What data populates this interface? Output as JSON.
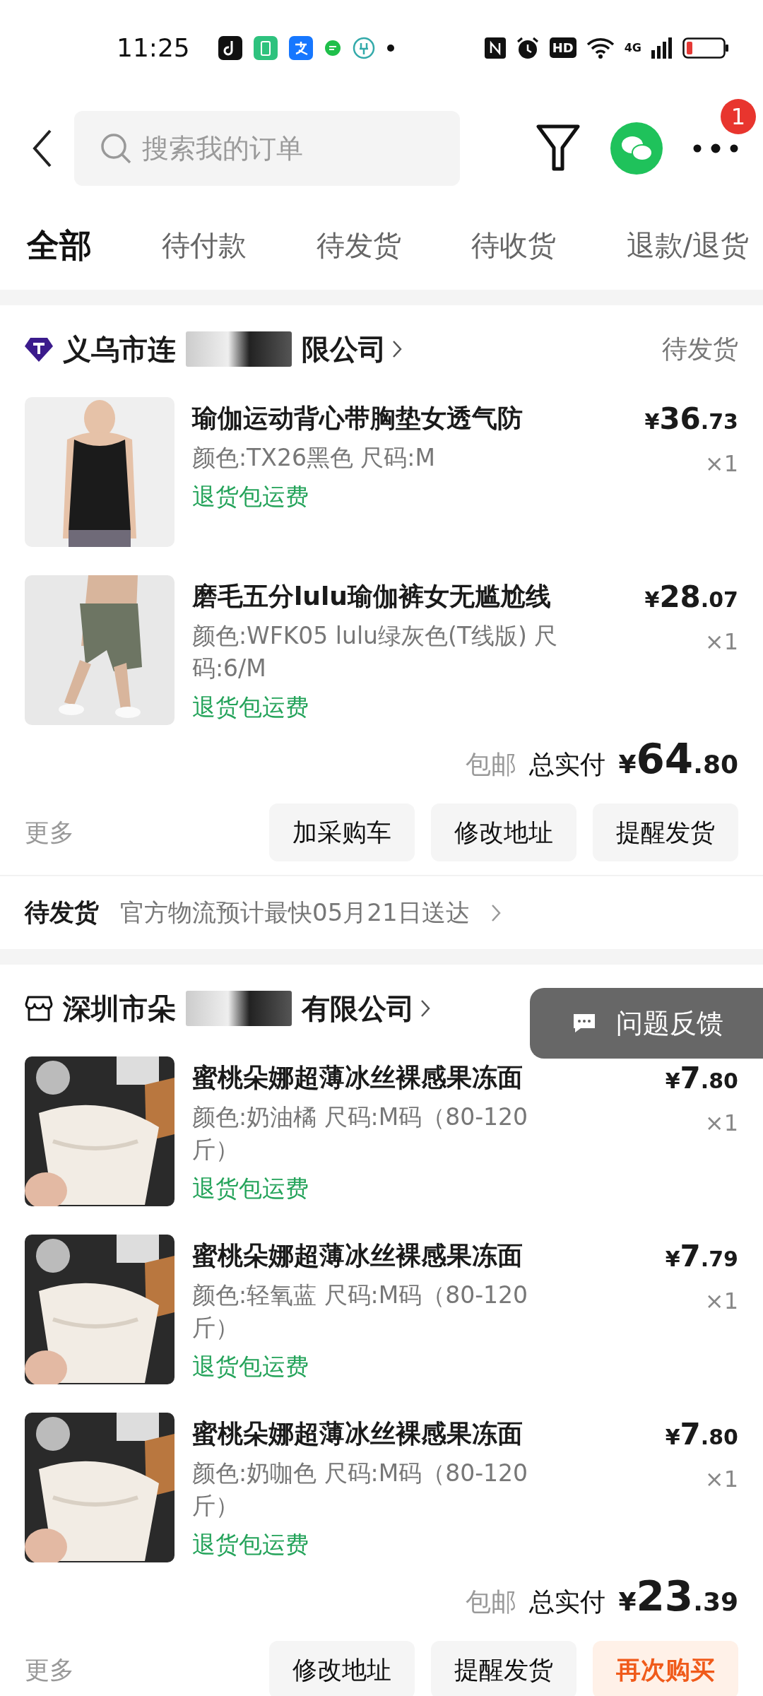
{
  "status_bar": {
    "time": "11:25",
    "hd": "HD",
    "network": "4G"
  },
  "header": {
    "search": {
      "placeholder": "搜索我的订单"
    },
    "badge": "1"
  },
  "tabs": [
    {
      "label": "全部",
      "selected": true
    },
    {
      "label": "待付款",
      "selected": false
    },
    {
      "label": "待发货",
      "selected": false
    },
    {
      "label": "待收货",
      "selected": false
    },
    {
      "label": "退款/退货",
      "selected": false
    }
  ],
  "orders": [
    {
      "kind": "brand",
      "shop_name_start": "义乌市连",
      "shop_name_end": "限公司",
      "status": "待发货",
      "items": [
        {
          "title": "瑜伽运动背心带胸垫女透气防",
          "spec": "颜色:TX26黑色 尺码:M",
          "tag": "退货包运费",
          "currency": "¥",
          "price_main": "36",
          "price_fraction": ".73",
          "quantity": "×1"
        },
        {
          "title": "磨毛五分lulu瑜伽裤女无尴尬线",
          "spec": "颜色:WFK05 lulu绿灰色(T线版) 尺码:6/M",
          "tag": "退货包运费",
          "currency": "¥",
          "price_main": "28",
          "price_fraction": ".07",
          "quantity": "×1"
        }
      ],
      "shipping": "包邮",
      "total_label": "总实付",
      "total_currency": "¥",
      "total_main": "64",
      "total_fraction": ".80",
      "more": "更多",
      "buttons": [
        {
          "label": "加采购车",
          "kind": "plain"
        },
        {
          "label": "修改地址",
          "kind": "plain"
        },
        {
          "label": "提醒发货",
          "kind": "plain"
        }
      ],
      "delivery": {
        "status": "待发货",
        "note": "官方物流预计最快05月21日送达"
      }
    },
    {
      "kind": "store",
      "shop_name_start": "深圳市朵",
      "shop_name_end": "有限公司",
      "items": [
        {
          "title": "蜜桃朵娜超薄冰丝裸感果冻面",
          "spec": "颜色:奶油橘 尺码:M码（80-120斤）",
          "tag": "退货包运费",
          "currency": "¥",
          "price_main": "7",
          "price_fraction": ".80",
          "quantity": "×1"
        },
        {
          "title": "蜜桃朵娜超薄冰丝裸感果冻面",
          "spec": "颜色:轻氧蓝 尺码:M码（80-120斤）",
          "tag": "退货包运费",
          "currency": "¥",
          "price_main": "7",
          "price_fraction": ".79",
          "quantity": "×1"
        },
        {
          "title": "蜜桃朵娜超薄冰丝裸感果冻面",
          "spec": "颜色:奶咖色 尺码:M码（80-120斤）",
          "tag": "退货包运费",
          "currency": "¥",
          "price_main": "7",
          "price_fraction": ".80",
          "quantity": "×1"
        }
      ],
      "shipping": "包邮",
      "total_label": "总实付",
      "total_currency": "¥",
      "total_main": "23",
      "total_fraction": ".39",
      "more": "更多",
      "buttons": [
        {
          "label": "修改地址",
          "kind": "plain"
        },
        {
          "label": "提醒发货",
          "kind": "plain"
        },
        {
          "label": "再次购买",
          "kind": "highlight"
        }
      ]
    }
  ],
  "feedback": {
    "label": "问题反馈"
  }
}
